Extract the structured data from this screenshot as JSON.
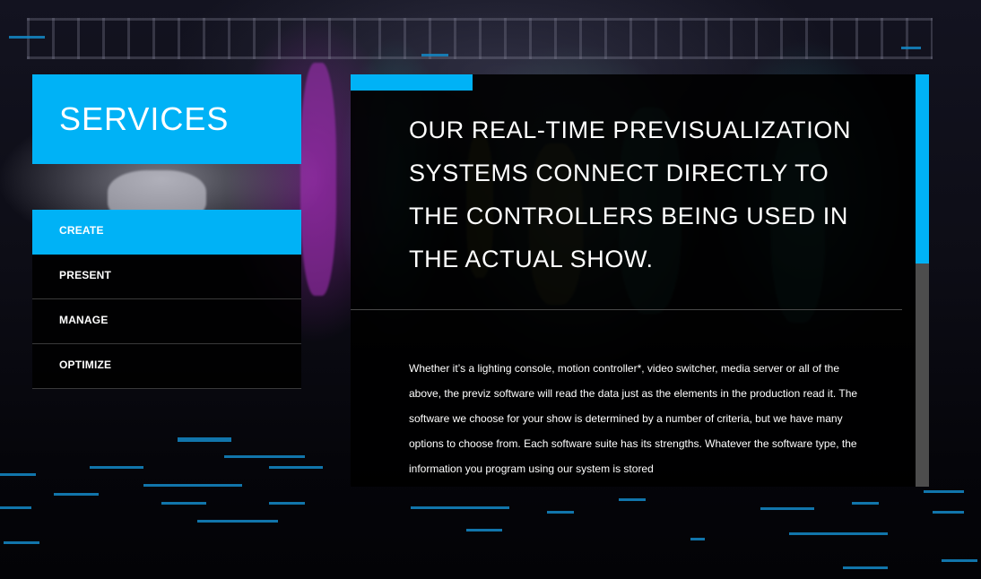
{
  "colors": {
    "accent": "#00b2f6",
    "panel": "#000000",
    "scroll_track": "#4d4d4d"
  },
  "sidebar": {
    "title": "SERVICES",
    "items": [
      {
        "label": "CREATE",
        "active": true
      },
      {
        "label": "PRESENT",
        "active": false
      },
      {
        "label": "MANAGE",
        "active": false
      },
      {
        "label": "OPTIMIZE",
        "active": false
      }
    ]
  },
  "content": {
    "headline": "OUR REAL-TIME PREVISUALIZATION SYSTEMS CONNECT DIRECTLY TO THE CONTROLLERS BEING USED IN THE ACTUAL SHOW.",
    "body": "Whether it’s a lighting console, motion controller*, video switcher, media server or all of the above, the previz software will read the data just as the elements in the production read it. The software we choose for your show is determined by a number of criteria, but we have many options to choose from. Each software suite has its strengths. Whatever the software type, the information you program using our system is stored"
  },
  "scroll": {
    "position_fraction": 0.0,
    "visible_fraction": 0.46
  }
}
